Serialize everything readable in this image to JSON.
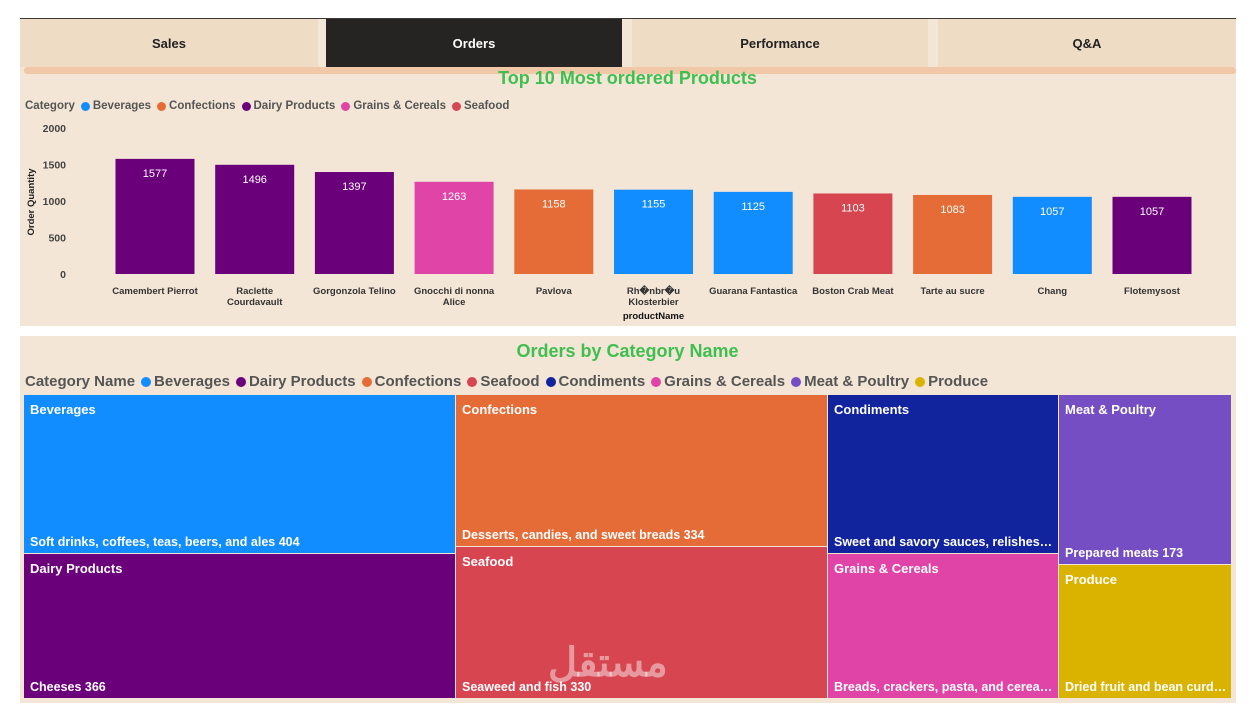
{
  "tabs": [
    {
      "label": "Sales",
      "active": false
    },
    {
      "label": "Orders",
      "active": true
    },
    {
      "label": "Performance",
      "active": false
    },
    {
      "label": "Q&A",
      "active": false
    }
  ],
  "colors": {
    "Beverages": "#118dff",
    "Confections": "#e66c37",
    "Dairy Products": "#6b007b",
    "Grains & Cereals": "#e044a7",
    "Seafood": "#d64550",
    "Condiments": "#12239e",
    "Meat & Poultry": "#744ec2",
    "Produce": "#d9b300",
    "title": "#3fbf4f"
  },
  "chart_data": [
    {
      "type": "bar",
      "title": "Top 10 Most ordered Products",
      "xlabel": "productName",
      "ylabel": "Order Quantity",
      "ylim": [
        0,
        2000
      ],
      "yticks": [
        "2000",
        "1500",
        "1000",
        "500",
        "0"
      ],
      "legend_title": "Category",
      "legend": [
        "Beverages",
        "Confections",
        "Dairy Products",
        "Grains & Cereals",
        "Seafood"
      ],
      "categories": [
        "Camembert Pierrot",
        "Raclette Courdavault",
        "Gorgonzola Telino",
        "Gnocchi di nonna Alice",
        "Pavlova",
        "Rh�nbr�u Klosterbier",
        "Guarana Fantastica",
        "Boston Crab Meat",
        "Tarte au sucre",
        "Chang",
        "Flotemysost"
      ],
      "category_labels": [
        [
          "Camembert Pierrot"
        ],
        [
          "Raclette",
          "Courdavault"
        ],
        [
          "Gorgonzola Telino"
        ],
        [
          "Gnocchi di nonna",
          "Alice"
        ],
        [
          "Pavlova"
        ],
        [
          "Rh�nbr�u",
          "Klosterbier"
        ],
        [
          "Guarana Fantastica"
        ],
        [
          "Boston Crab Meat"
        ],
        [
          "Tarte au sucre"
        ],
        [
          "Chang"
        ],
        [
          "Flotemysost"
        ]
      ],
      "values": [
        1577,
        1496,
        1397,
        1263,
        1158,
        1155,
        1125,
        1103,
        1083,
        1057,
        1057
      ],
      "bar_categories": [
        "Dairy Products",
        "Dairy Products",
        "Dairy Products",
        "Grains & Cereals",
        "Confections",
        "Beverages",
        "Beverages",
        "Seafood",
        "Confections",
        "Beverages",
        "Dairy Products"
      ]
    },
    {
      "type": "treemap",
      "title": "Orders by Category Name",
      "legend_title": "Category Name",
      "legend": [
        "Beverages",
        "Dairy Products",
        "Confections",
        "Seafood",
        "Condiments",
        "Grains & Cereals",
        "Meat & Poultry",
        "Produce"
      ],
      "tiles": [
        {
          "name": "Beverages",
          "desc": "Soft drinks, coffees, teas, beers, and ales 404",
          "value": 404
        },
        {
          "name": "Dairy Products",
          "desc": "Cheeses 366",
          "value": 366
        },
        {
          "name": "Confections",
          "desc": "Desserts, candies, and sweet breads 334",
          "value": 334
        },
        {
          "name": "Seafood",
          "desc": "Seaweed and fish 330",
          "value": 330
        },
        {
          "name": "Condiments",
          "desc": "Sweet and savory sauces, relishes, s...",
          "value": null
        },
        {
          "name": "Grains & Cereals",
          "desc": "Breads, crackers, pasta, and cereal ...",
          "value": null
        },
        {
          "name": "Meat & Poultry",
          "desc": "Prepared meats 173",
          "value": 173
        },
        {
          "name": "Produce",
          "desc": "Dried fruit and bean curd 1...",
          "value": null
        }
      ]
    }
  ],
  "watermark": "مستقل"
}
